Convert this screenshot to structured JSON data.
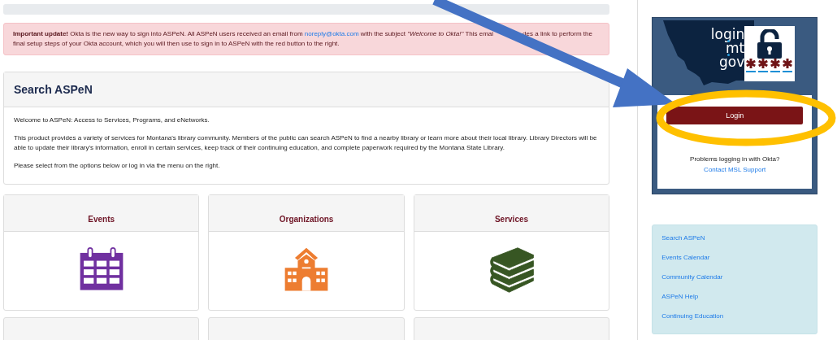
{
  "alert": {
    "text": "**Important update!** Okta is the new way to sign into ASPeN. All ASPeN users received an email from ",
    "link": "noreply@okta.com",
    "text_after": " with the subject *\"Welcome to Okta!\"* This emai",
    "text_end": "des a link to perform the final setup steps of your Okta account, which you will then use to sign in to ASPeN with the red button to the right."
  },
  "search_panel": {
    "title": "Search ASPeN",
    "paragraphs": [
      "Welcome to ASPeN: Access to Services, Programs, and eNetworks.",
      "This product provides a variety of services for Montana's library community. Members of the public can search ASPeN to find a nearby library or learn more about their local library. Library Directors will be able to update their library's information, enroll in certain services, keep track of their continuing education, and complete paperwork required by the Montana State Library.",
      "Please select from the options below or log in via the menu on the right."
    ]
  },
  "cards": [
    {
      "title": "Events",
      "kind": "calendar",
      "color": "#7030a0"
    },
    {
      "title": "Organizations",
      "kind": "school",
      "color": "#ed7d31"
    },
    {
      "title": "Services",
      "kind": "books",
      "color": "#375623"
    }
  ],
  "login_panel": {
    "logo_lines": [
      "login",
      "mt",
      "gov"
    ],
    "button": "Login",
    "help_text": "Problems logging in with Okta?",
    "help_link": "Contact MSL Support"
  },
  "links": [
    "Search ASPeN",
    "Events Calendar",
    "Community Calendar",
    "ASPeN Help",
    "Continuing Education"
  ],
  "annotations": [
    {
      "kind": "arrow",
      "color": "#4472c4"
    },
    {
      "kind": "ellipse",
      "color": "#ffc000"
    }
  ]
}
